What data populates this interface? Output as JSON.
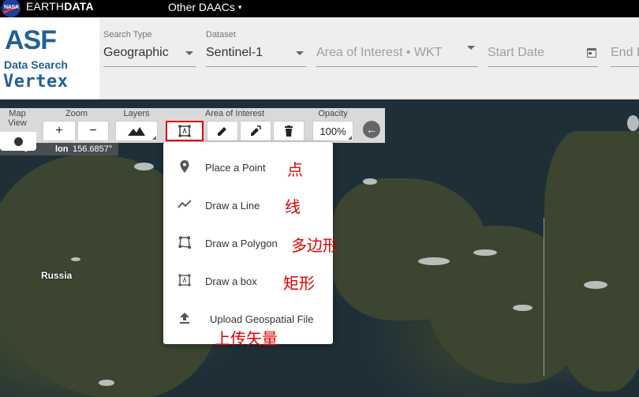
{
  "topbar": {
    "nasa_text": "NASA",
    "earthdata_left": "EARTH",
    "earthdata_right": "DATA",
    "other_daacs": "Other DAACs",
    "caret": "▾"
  },
  "logo": {
    "asf": "ASF",
    "data_search": "Data Search",
    "vertex": "Vertex"
  },
  "filters": {
    "search_type": {
      "label": "Search Type",
      "value": "Geographic"
    },
    "dataset": {
      "label": "Dataset",
      "value": "Sentinel-1"
    },
    "aoi": {
      "placeholder": "Area of Interest • WKT"
    },
    "start_date": {
      "placeholder": "Start Date"
    },
    "end_date": {
      "placeholder": "End D"
    }
  },
  "map": {
    "country_label": "Russia",
    "coords": {
      "lat_partial": "9°",
      "lon_label": "lon",
      "lon_value": "156.6857°"
    }
  },
  "toolbar": {
    "map_view_label": "Map View",
    "zoom_label": "Zoom",
    "zoom_in": "+",
    "zoom_out": "−",
    "layers_label": "Layers",
    "aoi_label": "Area of Interest",
    "opacity_label": "Opacity",
    "opacity_value": "100%"
  },
  "draw_menu": {
    "items": [
      {
        "icon": "place-icon",
        "label": "Place a Point",
        "annotation": "点"
      },
      {
        "icon": "line-icon",
        "label": "Draw a Line",
        "annotation": "线"
      },
      {
        "icon": "polygon-icon",
        "label": "Draw a Polygon",
        "annotation": "多边形"
      },
      {
        "icon": "box-icon",
        "label": "Draw a box",
        "annotation": "矩形"
      },
      {
        "icon": "upload-icon",
        "label": "Upload Geospatial File",
        "annotation": "上传矢量"
      }
    ]
  },
  "colors": {
    "brand": "#236192",
    "highlight": "#e00000",
    "topbar": "#000000"
  }
}
